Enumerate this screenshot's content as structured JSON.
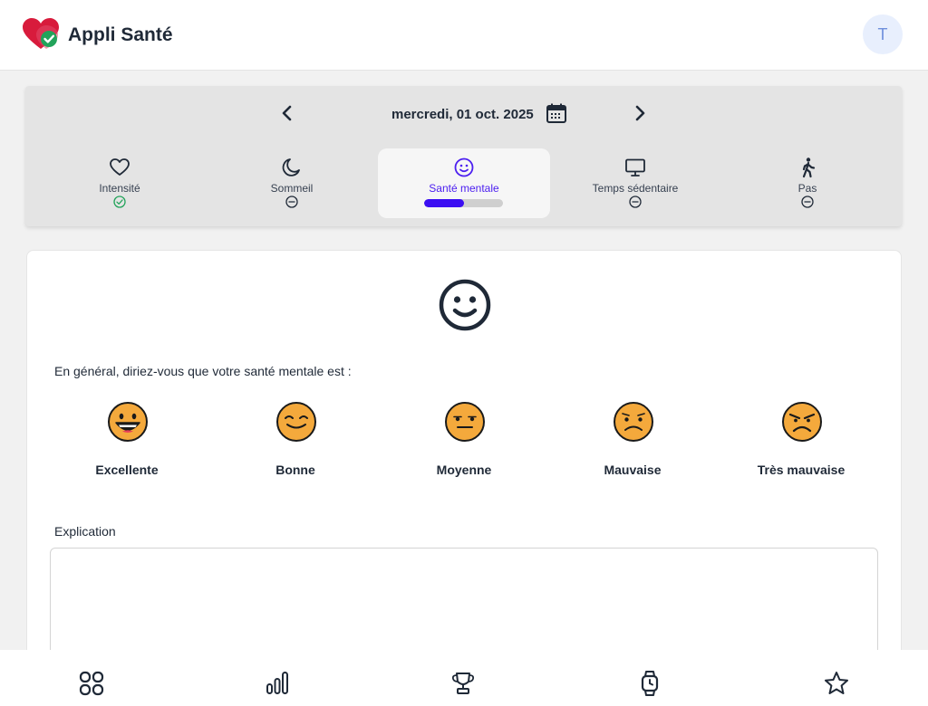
{
  "header": {
    "app_title": "Appli Santé",
    "avatar_initial": "T"
  },
  "date_nav": {
    "date": "mercredi, 01 oct. 2025"
  },
  "tabs": [
    {
      "label": "Intensité",
      "icon": "heart-icon",
      "status": "completed"
    },
    {
      "label": "Sommeil",
      "icon": "moon-icon",
      "status": "empty"
    },
    {
      "label": "Santé mentale",
      "icon": "smiley-icon",
      "status": "in-progress",
      "progress": 0.5
    },
    {
      "label": "Temps sédentaire",
      "icon": "monitor-icon",
      "status": "empty"
    },
    {
      "label": "Pas",
      "icon": "walking-icon",
      "status": "empty"
    }
  ],
  "form": {
    "question": "En général, diriez-vous que votre santé mentale est :",
    "choices": [
      {
        "label": "Excellente",
        "icon": "grinning-face-icon"
      },
      {
        "label": "Bonne",
        "icon": "content-face-icon"
      },
      {
        "label": "Moyenne",
        "icon": "neutral-face-icon"
      },
      {
        "label": "Mauvaise",
        "icon": "unhappy-face-icon"
      },
      {
        "label": "Très mauvaise",
        "icon": "angry-face-icon"
      }
    ],
    "explanation_label": "Explication",
    "explanation_value": ""
  },
  "bottom_nav": [
    {
      "icon": "grid-icon"
    },
    {
      "icon": "bar-chart-icon"
    },
    {
      "icon": "trophy-icon"
    },
    {
      "icon": "watch-icon"
    },
    {
      "icon": "star-icon"
    }
  ],
  "colors": {
    "accent": "#3b0ef2",
    "accent_text": "#4c1ff0",
    "success": "#22a35a",
    "emoji_fill": "#f4a93c",
    "heart_red": "#d81b3c"
  }
}
